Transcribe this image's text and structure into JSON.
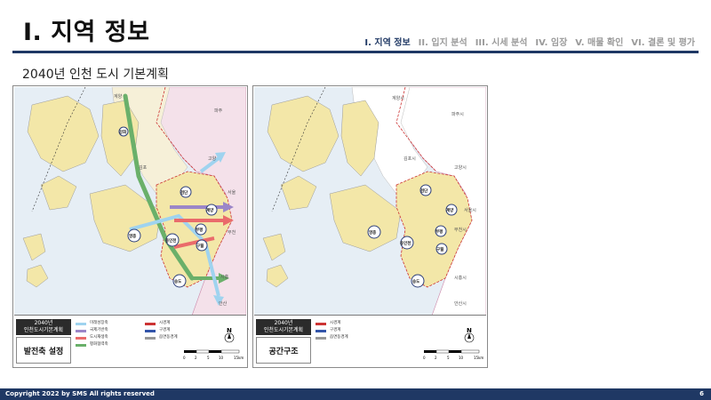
{
  "header": {
    "title": "I. 지역 정보",
    "nav": [
      "I. 지역 정보",
      "II. 입지 분석",
      "III. 시세 분석",
      "IV. 임장",
      "V. 매물 확인",
      "VI. 결론 및 평가"
    ],
    "active_index": 0
  },
  "subtitle": "2040년 인천 도시 기본계획",
  "left_panel": {
    "legend_head": "2040년\n인천도시기본계획",
    "legend_title": "발전축 설정",
    "legend_items": [
      "미래성장축",
      "국제기반축",
      "도시재생축",
      "평화협력축"
    ],
    "legend_items2": [
      "시경계",
      "구경계",
      "읍면동경계"
    ],
    "axis_colors": [
      "#9fd3ef",
      "#9b86c8",
      "#ea6b6b",
      "#6ab06a"
    ],
    "map_labels": [
      "계양",
      "파주",
      "고양",
      "김포",
      "서울",
      "부천",
      "시흥",
      "안산"
    ],
    "centers": [
      "강화",
      "영종",
      "검단",
      "계양",
      "동인천",
      "부평",
      "구월",
      "송도"
    ]
  },
  "right_panel": {
    "legend_head": "2040년\n인천도시기본계획",
    "legend_title": "공간구조",
    "legend_items": [
      "시경계",
      "구경계",
      "읍면동경계"
    ],
    "map_labels": [
      "계양시",
      "파주시",
      "김포시",
      "고양시",
      "서울시",
      "부천시",
      "시흥시",
      "안산시"
    ],
    "centers": [
      "영종",
      "검단",
      "계양",
      "동인천",
      "부평",
      "구월",
      "송도"
    ]
  },
  "scale": {
    "north": "N",
    "ticks": [
      "0",
      "2",
      "5",
      "10",
      "15km"
    ]
  },
  "footer": {
    "copyright": "Copyright 2022 by SMS  All rights reserved",
    "page": "6"
  }
}
